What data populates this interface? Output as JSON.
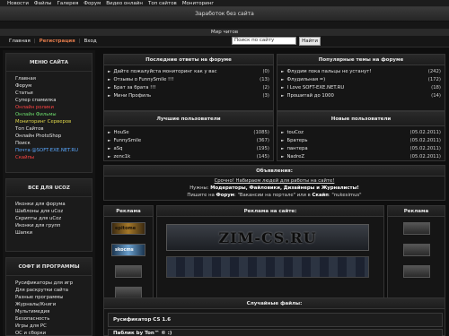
{
  "topnav": [
    "Новости",
    "Файлы",
    "Галерея",
    "Форум",
    "Видео онлайн",
    "Топ сайтов",
    "Мониторинг"
  ],
  "banner1": "Заработок без сайта",
  "banner2": "Мир читов",
  "navbar": {
    "links": [
      "Главная",
      "Регистрация",
      "Вход"
    ],
    "separator": "|"
  },
  "search": {
    "value": "Поиск по сайту",
    "button": "Найти"
  },
  "sidebar": {
    "menu": {
      "title": "МЕНЮ САЙТА",
      "items": [
        {
          "label": "Главная",
          "color": "#e6e6e6"
        },
        {
          "label": "Форум",
          "color": "#e6e6e6"
        },
        {
          "label": "Статьи",
          "color": "#e6e6e6"
        },
        {
          "label": "Супер спамилка",
          "color": "#e6e6e6"
        },
        {
          "label": "Онлайн ролики",
          "color": "#ff4444"
        },
        {
          "label": "Онлайн Фильмы",
          "color": "#6ddf6d"
        },
        {
          "label": "Мониторинг Серверов",
          "color": "#e2d94a"
        },
        {
          "label": "Топ Сайтов",
          "color": "#e6e6e6"
        },
        {
          "label": "Онлайн PhotoShop",
          "color": "#e6e6e6"
        },
        {
          "label": "Поиск",
          "color": "#e6e6e6"
        },
        {
          "label": "Почта @SOFT-EXE.NET.RU",
          "color": "#5aa8ff"
        },
        {
          "label": "Скайпы",
          "color": "#ff4444"
        }
      ]
    },
    "ucoz": {
      "title": "ВСЕ ДЛЯ UCOZ",
      "items": [
        "Иконки для форума",
        "Шаблоны для uCoz",
        "Скрипты для uCoz",
        "Иконки для групп",
        "Шапки"
      ]
    },
    "soft": {
      "title": "СОФТ И ПРОГРАММЫ",
      "items": [
        "Русификаторы для игр",
        "Для раскрутки сайта",
        "Разные программы",
        "Журналы/Книги",
        "Мультимедия",
        "Безопасность",
        "Игры для PC",
        "ОС и сборки"
      ]
    }
  },
  "forum_replies": {
    "title": "Последние ответы на форуме",
    "rows": [
      {
        "text": "Дайте пожалуйста мониторинг как у вас",
        "count": "(0)"
      },
      {
        "text": "Отзывы о FunnySmile !!!",
        "count": "(13)"
      },
      {
        "text": "Брат за брата !!!",
        "count": "(2)"
      },
      {
        "text": "Мини Профиль",
        "count": "(3)"
      }
    ]
  },
  "popular_topics": {
    "title": "Популярные темы на форуме",
    "rows": [
      {
        "text": "Флудим пока пальцы не устанут!",
        "count": "(242)"
      },
      {
        "text": "Флудильная =)",
        "count": "(172)"
      },
      {
        "text": "I Love SOFT-EXE.NET.RU",
        "count": "(18)"
      },
      {
        "text": "Прошитай до 1000",
        "count": "(14)"
      }
    ]
  },
  "best_users": {
    "title": "Лучшие пользователи",
    "rows": [
      {
        "text": "HouSe",
        "count": "(1085)"
      },
      {
        "text": "FunnySmile",
        "count": "(367)"
      },
      {
        "text": "aSq",
        "count": "(195)"
      },
      {
        "text": "zenc1k",
        "count": "(145)"
      }
    ]
  },
  "new_users": {
    "title": "Новые пользователи",
    "rows": [
      {
        "text": "touCoz",
        "count": "(05.02.2011)"
      },
      {
        "text": "Братерь",
        "count": "(05.02.2011)"
      },
      {
        "text": "пантера",
        "count": "(05.02.2011)"
      },
      {
        "text": "NadreZ",
        "count": "(05.02.2011)"
      }
    ]
  },
  "announcements": {
    "title": "Объявления:",
    "line1": "Срочно! Набираем людей для работы на сайте!",
    "line2_prefix": "Нужны:",
    "line2_bold": "Модераторы, Файловики, Дизайнеры и Журналисты!",
    "line3_prefix": "Пишите на",
    "line3_bold1": "Форум",
    "line3_mid": ": \"Вакансии на портале\" или в",
    "line3_bold2": "Скайп",
    "line3_end": ": \"nukesimus\""
  },
  "ads": {
    "left_title": "Реклама",
    "center_title": "Реклама на сайте:",
    "right_title": "Реклама",
    "thumb_labels": [
      "epitome",
      "skocms"
    ],
    "center_banner": "ZIM-CS.RU"
  },
  "files": {
    "title": "Случайные файлы:",
    "items": [
      "Русификатор CS 1.6",
      "Паблик by Ton™ © :)"
    ]
  }
}
